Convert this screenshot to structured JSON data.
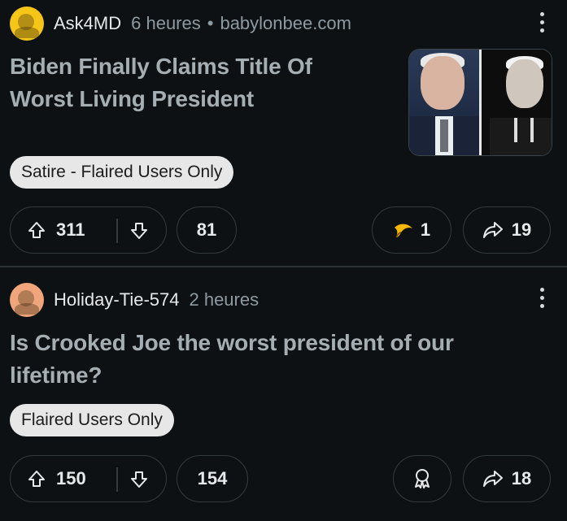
{
  "posts": [
    {
      "username": "Ask4MD",
      "time": "6 heures",
      "separator": "•",
      "domain": "babylonbee.com",
      "title_line1": "Biden Finally Claims Title Of",
      "title_line2": "Worst Living President",
      "flair": "Satire - Flaired Users Only",
      "score": "311",
      "comments": "81",
      "awards": "1",
      "shares": "19",
      "avatar_color": "#f5c518"
    },
    {
      "username": "Holiday-Tie-574",
      "time": "2 heures",
      "title_line1": "Is Crooked Joe the worst president of our",
      "title_line2": "lifetime?",
      "flair": "Flaired Users Only",
      "score": "150",
      "comments": "154",
      "shares": "18",
      "avatar_color": "#f0a67a"
    }
  ],
  "icons": {
    "upvote": "upvote-arrow-icon",
    "downvote": "downvote-arrow-icon",
    "award": "award-icon",
    "share": "share-arrow-icon",
    "more": "more-options-icon"
  }
}
